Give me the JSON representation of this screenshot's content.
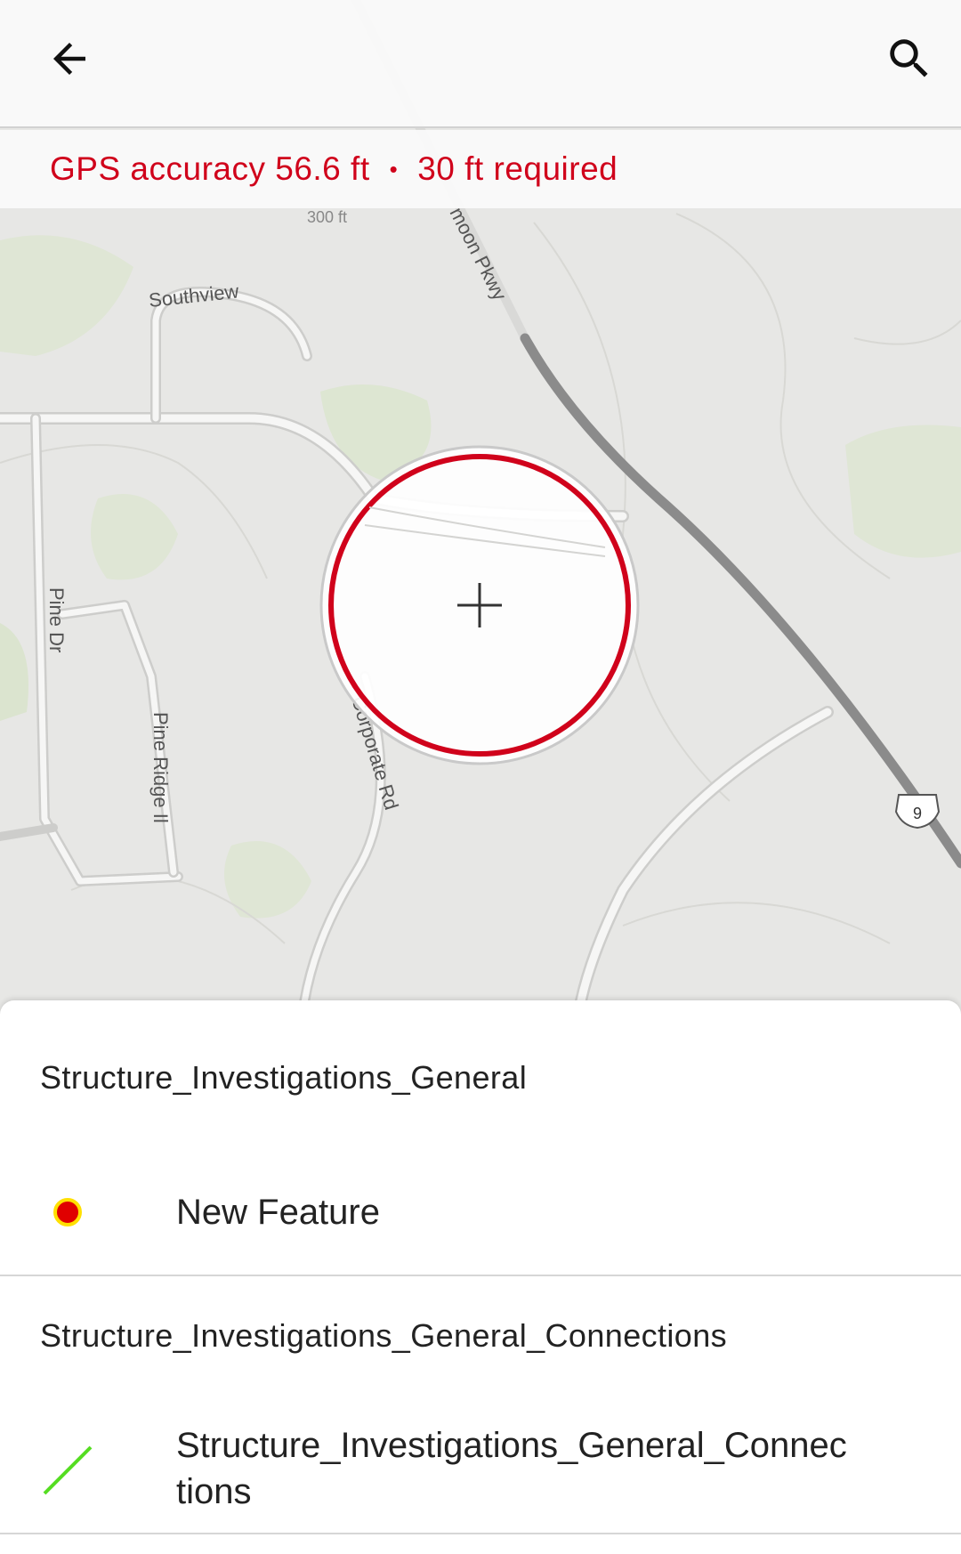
{
  "toolbar": {
    "back_icon": "arrow-left-icon",
    "search_icon": "search-icon"
  },
  "gps": {
    "accuracy_text": "GPS accuracy 56.6 ft",
    "separator": "•",
    "required_text": "30 ft required",
    "color": "#d0021b"
  },
  "map": {
    "labels": {
      "road_pkwy": "moon Pkwy",
      "southview": "Southview",
      "pine_dr": "Pine Dr",
      "pine_ridge": "Pine Ridge Il",
      "corporate_rd": "Corporate Rd",
      "contour": "300 ft",
      "route_shield": "9"
    },
    "accuracy_ring_color": "#d0021b",
    "crosshair_icon": "crosshair-icon"
  },
  "templates": {
    "groups": [
      {
        "header": "Structure_Investigations_General",
        "items": [
          {
            "label": "New Feature",
            "symbol": "point-symbol-icon",
            "fill": "#e00000",
            "outline": "#ffe000"
          }
        ]
      },
      {
        "header": "Structure_Investigations_General_Connections",
        "items": [
          {
            "label": "Structure_Investigations_General_Connec\ntions",
            "symbol": "line-symbol-icon",
            "color": "#55dd22"
          }
        ]
      }
    ]
  }
}
